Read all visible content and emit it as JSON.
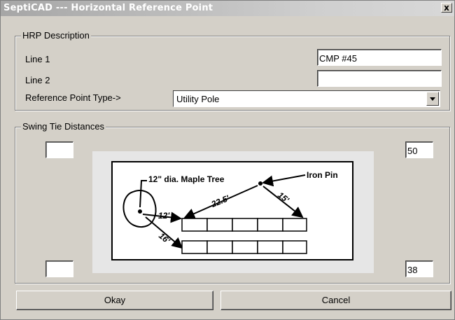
{
  "window": {
    "title": "SeptiCAD --- Horizontal Reference Point",
    "close_glyph": "x"
  },
  "hrp": {
    "group_label": "HRP Description",
    "line1_label": "Line 1",
    "line1_value": "CMP #45",
    "line2_label": "Line 2",
    "line2_value": "",
    "ref_type_label": "Reference Point Type->",
    "ref_type_value": "Utility Pole"
  },
  "swing": {
    "group_label": "Swing Tie Distances",
    "top_left_value": "",
    "top_right_value": "50",
    "bottom_left_value": "",
    "bottom_right_value": "38"
  },
  "diagram": {
    "tree_label": "12\" dia. Maple Tree",
    "pin_label": "Iron Pin",
    "dist_a": "12'",
    "dist_b": "22.5'",
    "dist_c": "15'",
    "dist_d": "16'"
  },
  "buttons": {
    "okay": "Okay",
    "cancel": "Cancel"
  }
}
